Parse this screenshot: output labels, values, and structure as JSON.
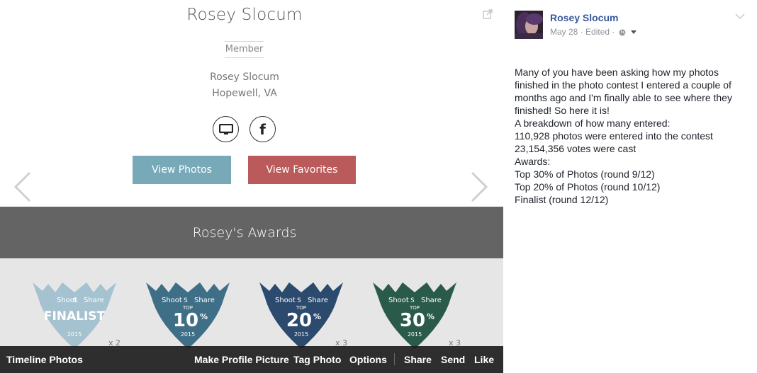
{
  "profile": {
    "name": "Rosey Slocum",
    "badge": "Member",
    "display_name": "Rosey Slocum",
    "location": "Hopewell, VA",
    "view_photos_label": "View Photos",
    "view_favorites_label": "View Favorites",
    "awards_heading": "Rosey's Awards"
  },
  "awards": [
    {
      "brand": "Shoot",
      "brand2": "Share",
      "top": "",
      "big": "FINALIST",
      "year": "2015",
      "count": "x 2",
      "color": "#a5c2d0"
    },
    {
      "brand": "Shoot",
      "brand2": "Share",
      "top": "TOP",
      "big": "10",
      "suffix": "%",
      "year": "2015",
      "count": "",
      "color": "#3f6f86"
    },
    {
      "brand": "Shoot",
      "brand2": "Share",
      "top": "TOP",
      "big": "20",
      "suffix": "%",
      "year": "2015",
      "count": "x 3",
      "color": "#2c4a6e"
    },
    {
      "brand": "Shoot",
      "brand2": "Share",
      "top": "TOP",
      "big": "30",
      "suffix": "%",
      "year": "2015",
      "count": "x 3",
      "color": "#2a5a4a"
    }
  ],
  "toolbar": {
    "title": "Timeline Photos",
    "make_profile": "Make Profile Picture",
    "tag_photo": "Tag Photo",
    "options": "Options",
    "share": "Share",
    "send": "Send",
    "like": "Like"
  },
  "post": {
    "author": "Rosey Slocum",
    "date": "May 28",
    "edited": "Edited",
    "lines": [
      "Many of you have been asking how my photos finished in the photo contest I entered a couple of months ago and I'm finally able to see where they finished! So here it is!",
      "A breakdown of how many entered:",
      "110,928 photos were entered into the contest",
      "23,154,356 votes were cast",
      "Awards:",
      "Top 30% of Photos (round 9/12)",
      "Top 20% of Photos (round 10/12)",
      "Finalist (round 12/12)"
    ]
  },
  "icons": {
    "expand": "expand-icon",
    "website": "monitor-icon",
    "facebook": "facebook-icon",
    "prev": "chevron-left-icon",
    "next": "chevron-right-icon",
    "privacy": "globe-icon",
    "menu": "chevron-down-icon"
  },
  "colors": {
    "view_photos": "#78a9b9",
    "view_favorites": "#bb5a5a",
    "awards_bar": "#646464",
    "author_link": "#365899"
  }
}
